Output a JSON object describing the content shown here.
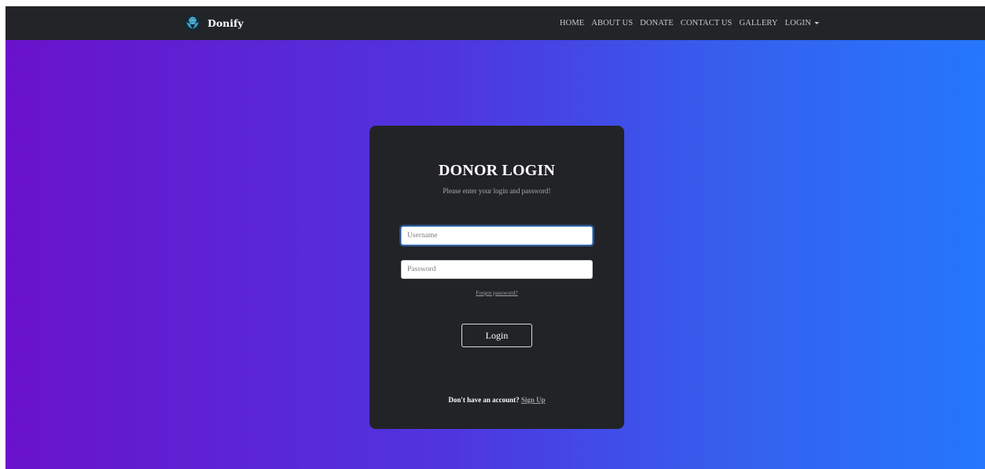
{
  "navbar": {
    "brand_name": "Donify",
    "logo_icon": "hands-holding-globe-icon",
    "links": [
      {
        "label": "HOME"
      },
      {
        "label": "ABOUT US"
      },
      {
        "label": "DONATE"
      },
      {
        "label": "CONTACT US"
      },
      {
        "label": "GALLERY"
      },
      {
        "label": "LOGIN",
        "has_dropdown": true
      }
    ]
  },
  "login_card": {
    "title": "DONOR LOGIN",
    "subtitle": "Please enter your login and password!",
    "username": {
      "placeholder": "Username",
      "value": "",
      "focused": true
    },
    "password": {
      "placeholder": "Password",
      "value": ""
    },
    "forgot_password": "Forgot password?",
    "login_button": "Login",
    "signup_prompt": "Don't have an account?",
    "signup_link": "Sign Up"
  },
  "colors": {
    "navbar_bg": "#222427",
    "card_bg": "#222326",
    "gradient_start": "#6a12cb",
    "gradient_end": "#2577fd"
  }
}
